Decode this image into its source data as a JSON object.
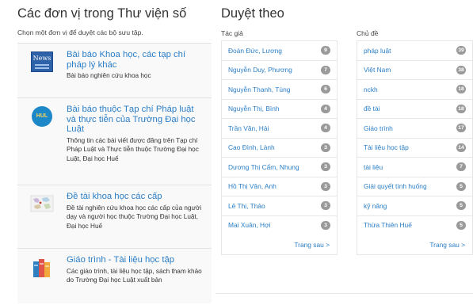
{
  "communities": {
    "title": "Các đơn vị trong Thư viện số",
    "subtitle": "Chọn một đơn vị để duyệt các bộ sưu tập.",
    "items": [
      {
        "title": "Bài báo Khoa học, các tạp chí pháp lý khác",
        "desc": "Bài báo nghiên cứu khoa học",
        "icon": "news-icon"
      },
      {
        "title": "Bài báo thuộc Tạp chí Pháp luật và thực tiễn của Trường Đại học Luật",
        "desc": "Thông tin các bài viết được đăng trên Tạp chí Pháp Luật và Thực tiễn thuộc Trường Đại học Luật, Đại học Huế",
        "icon": "hul-logo-icon",
        "logo_text": "HUL"
      },
      {
        "title": "Đề tài khoa học các cấp",
        "desc": "Đề tài nghiên cứu khoa học các cấp của người dạy và người học thuộc Trường Đại học Luật, Đại học Huế",
        "icon": "map-icon"
      },
      {
        "title": "Giáo trình - Tài liệu học tập",
        "desc": "Các giáo trình, tài liệu học tập, sách tham khảo do Trường Đại học Luật xuất bản",
        "icon": "books-icon"
      }
    ]
  },
  "browse": {
    "title": "Duyệt theo",
    "authors": {
      "heading": "Tác giả",
      "items": [
        {
          "label": "Đoàn Đức, Lương",
          "count": "9"
        },
        {
          "label": "Nguyễn Duy, Phương",
          "count": "7"
        },
        {
          "label": "Nguyễn Thanh, Tùng",
          "count": "6"
        },
        {
          "label": "Nguyễn Thị, Bình",
          "count": "4"
        },
        {
          "label": "Trần Văn, Hải",
          "count": "4"
        },
        {
          "label": "Cao Đình, Lành",
          "count": "3"
        },
        {
          "label": "Dương Thị Cẩm, Nhung",
          "count": "3"
        },
        {
          "label": "Hồ Thị Vân, Anh",
          "count": "3"
        },
        {
          "label": "Lê Thị, Thảo",
          "count": "3"
        },
        {
          "label": "Mai Xuân, Hợi",
          "count": "3"
        }
      ],
      "next": "Trang sau >"
    },
    "subjects": {
      "heading": "Chủ đề",
      "items": [
        {
          "label": "pháp luật",
          "count": "39"
        },
        {
          "label": "Việt Nam",
          "count": "38"
        },
        {
          "label": "nckh",
          "count": "18"
        },
        {
          "label": "đề tài",
          "count": "18"
        },
        {
          "label": "Giáo trình",
          "count": "17"
        },
        {
          "label": "Tài liệu học tập",
          "count": "14"
        },
        {
          "label": "tài liệu",
          "count": "7"
        },
        {
          "label": "Giải quyết tình huống",
          "count": "5"
        },
        {
          "label": "kỹ năng",
          "count": "5"
        },
        {
          "label": "Thừa Thiên Huế",
          "count": "5"
        }
      ],
      "next": "Trang sau >"
    }
  }
}
